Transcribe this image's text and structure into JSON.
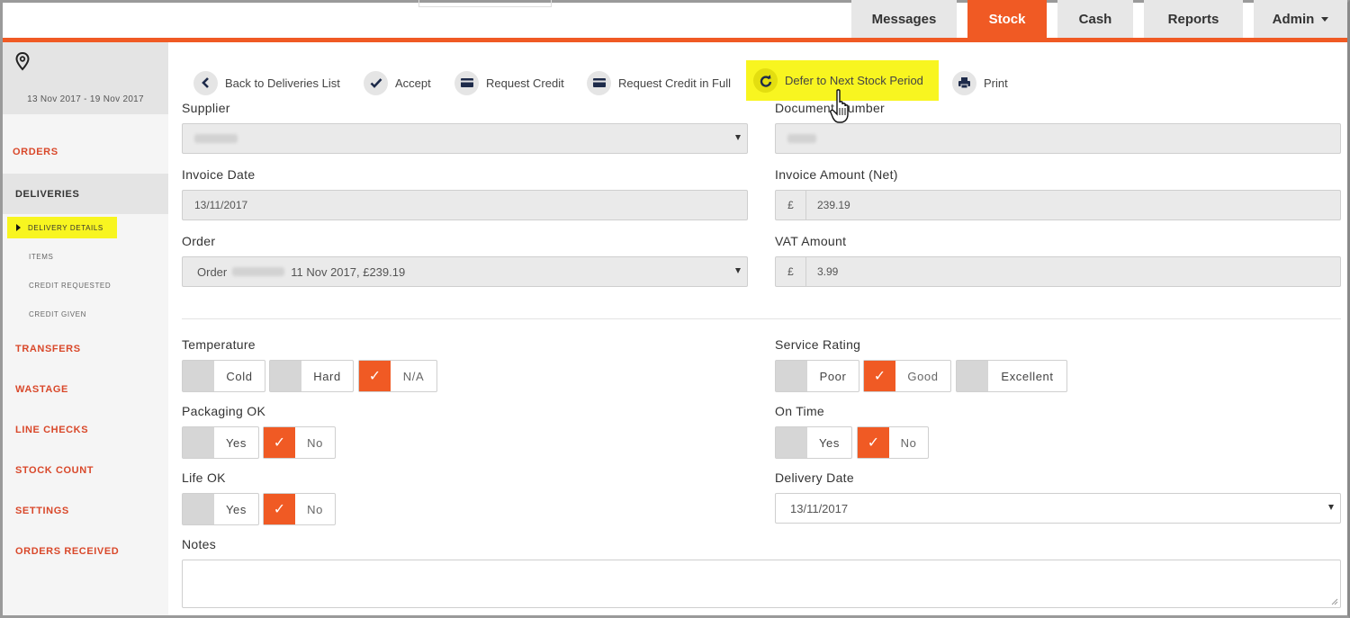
{
  "topnav": {
    "tabs": [
      {
        "label": "Messages",
        "active": false
      },
      {
        "label": "Stock",
        "active": true
      },
      {
        "label": "Cash",
        "active": false
      },
      {
        "label": "Reports",
        "active": false
      },
      {
        "label": "Admin",
        "active": false,
        "dropdown": true
      }
    ]
  },
  "sidebar": {
    "location_icon": "map-pin-icon",
    "date_range": "13 Nov 2017 - 19 Nov 2017",
    "items": [
      {
        "label": "ORDERS"
      },
      {
        "label": "DELIVERIES"
      },
      {
        "label": "TRANSFERS"
      },
      {
        "label": "WASTAGE"
      },
      {
        "label": "LINE CHECKS"
      },
      {
        "label": "STOCK COUNT"
      },
      {
        "label": "SETTINGS"
      },
      {
        "label": "ORDERS RECEIVED"
      }
    ],
    "sub_items": [
      {
        "label": "DELIVERY DETAILS"
      },
      {
        "label": "ITEMS"
      },
      {
        "label": "CREDIT REQUESTED"
      },
      {
        "label": "CREDIT GIVEN"
      }
    ]
  },
  "toolbar": {
    "back": "Back to Deliveries List",
    "accept": "Accept",
    "request_credit": "Request Credit",
    "request_credit_full": "Request Credit in Full",
    "defer": "Defer to Next Stock Period",
    "print": "Print"
  },
  "form": {
    "supplier_label": "Supplier",
    "document_number_label": "Document Number",
    "invoice_date_label": "Invoice Date",
    "invoice_date_value": "13/11/2017",
    "invoice_amount_label": "Invoice Amount (Net)",
    "currency": "£",
    "invoice_amount_value": "239.19",
    "order_label": "Order",
    "order_prefix": "Order",
    "order_suffix": "11 Nov 2017, £239.19",
    "vat_label": "VAT Amount",
    "vat_value": "3.99",
    "temperature_label": "Temperature",
    "temperature_options": [
      "Cold",
      "Hard",
      "N/A"
    ],
    "temperature_selected": "N/A",
    "service_label": "Service Rating",
    "service_options": [
      "Poor",
      "Good",
      "Excellent"
    ],
    "service_selected": "Good",
    "packaging_label": "Packaging OK",
    "on_time_label": "On Time",
    "life_label": "Life OK",
    "yes": "Yes",
    "no": "No",
    "check": "✓",
    "delivery_date_label": "Delivery Date",
    "delivery_date_value": "13/11/2017",
    "notes_label": "Notes"
  },
  "colors": {
    "accent": "#f05a24",
    "highlight": "#f8f520",
    "link_red": "#d9482a"
  }
}
